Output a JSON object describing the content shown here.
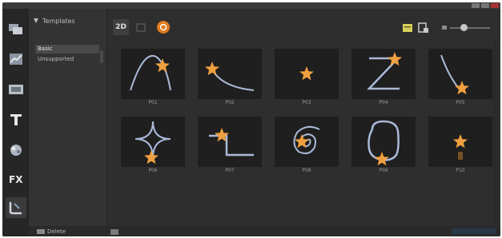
{
  "window": {
    "title": ""
  },
  "sidebar": {
    "tools": [
      {
        "name": "tool-overlay",
        "icon": "overlay-icon"
      },
      {
        "name": "tool-graphics",
        "icon": "graph-icon"
      },
      {
        "name": "tool-title-media",
        "icon": "media-icon"
      },
      {
        "name": "tool-text",
        "icon": "text-icon"
      },
      {
        "name": "tool-fx",
        "icon": "fx-icon"
      },
      {
        "name": "tool-fx2",
        "icon": "fx2-icon"
      },
      {
        "name": "tool-motion-path",
        "icon": "motion-path-icon"
      }
    ],
    "active_index": 6
  },
  "library": {
    "header": "Templates",
    "items": [
      "Basic",
      "Unsupported"
    ],
    "selected_index": 0
  },
  "toolbar": {
    "button_2d": "2D",
    "zoom_level": 0.35
  },
  "paths": {
    "captions": [
      "P01",
      "P02",
      "P03",
      "P04",
      "P05",
      "P06",
      "P07",
      "P08",
      "P09",
      "P10"
    ]
  },
  "bottom": {
    "delete_label": "Delete"
  },
  "colors": {
    "path_line": "#a9b9d8",
    "star_fill": "#f0a040",
    "star_glow": "#c07a2a",
    "accent_orange": "#e07b1e"
  }
}
